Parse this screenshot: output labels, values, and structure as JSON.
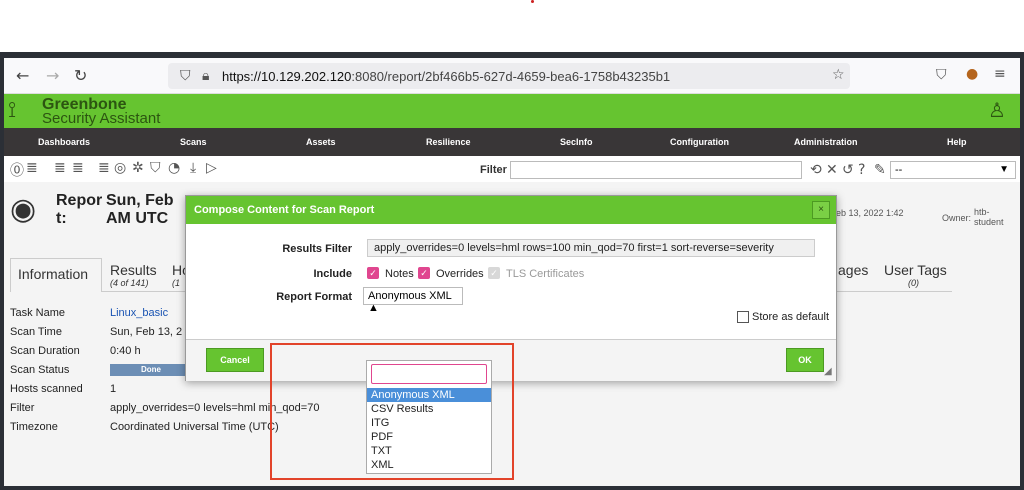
{
  "browser": {
    "url_host": "https://10.129.202.120",
    "url_path": ":8080/report/2bf466b5-627d-4659-bea6-1758b43235b1"
  },
  "app": {
    "logo_line1": "Greenbone",
    "logo_line2": "Security Assistant",
    "menu": [
      "Dashboards",
      "Scans",
      "Assets",
      "Resilience",
      "SecInfo",
      "Configuration",
      "Administration",
      "Help"
    ],
    "filter_label": "Filter",
    "filter_select": "--"
  },
  "report": {
    "title_a": "Repor",
    "title_b": "t:",
    "title_c": "Sun, Feb",
    "title_d": "AM UTC",
    "date_right": "eb 13, 2022 1:42",
    "owner_label": "Owner:",
    "owner_value_1": "htb-",
    "owner_value_2": "student"
  },
  "tabs": {
    "information": "Information",
    "results": "Results",
    "results_count": "(4 of 141)",
    "hosts_partial": "Ho",
    "hosts_count": "(1",
    "ages_partial": "ages",
    "user_tags": "User Tags",
    "user_tags_count": "(0)"
  },
  "details": {
    "rows": [
      {
        "label": "Task Name",
        "value": "Linux_basic"
      },
      {
        "label": "Scan Time",
        "value": "Sun, Feb 13, 2"
      },
      {
        "label": "Scan Duration",
        "value": "0:40 h"
      },
      {
        "label": "Scan Status",
        "value": "Done"
      },
      {
        "label": "Hosts scanned",
        "value": "1"
      },
      {
        "label": "Filter",
        "value": "apply_overrides=0 levels=hml min_qod=70"
      },
      {
        "label": "Timezone",
        "value": "Coordinated Universal Time (UTC)"
      }
    ]
  },
  "dialog": {
    "title": "Compose Content for Scan Report",
    "close": "×",
    "results_filter_label": "Results Filter",
    "results_filter_value": "apply_overrides=0 levels=hml rows=100 min_qod=70 first=1 sort-reverse=severity",
    "include_label": "Include",
    "include_notes": "Notes",
    "include_overrides": "Overrides",
    "include_tls": "TLS Certificates",
    "report_format_label": "Report Format",
    "report_format_value": "Anonymous XML ▲",
    "store_default": "Store as default",
    "cancel": "Cancel",
    "ok": "OK"
  },
  "dropdown": {
    "options": [
      "Anonymous XML",
      "CSV Results",
      "ITG",
      "PDF",
      "TXT",
      "XML"
    ],
    "selected_index": 0
  },
  "colors": {
    "brand_green": "#66c430",
    "menu_bg": "#393637",
    "highlight_red": "#e2432a",
    "checkbox_pink": "#e0468f"
  }
}
